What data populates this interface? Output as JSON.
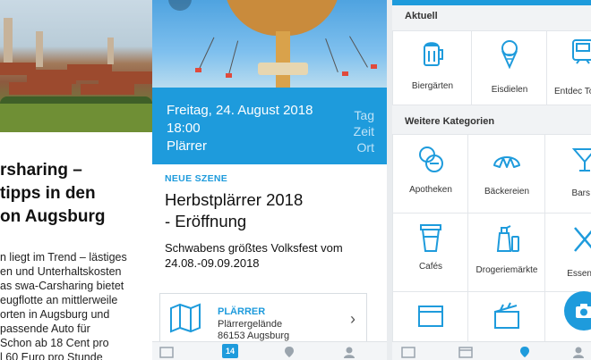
{
  "article": {
    "title_lines": [
      "rsharing –",
      "tipps in den",
      "on Augsburg"
    ],
    "body_lines": [
      "n liegt im Trend – lästiges",
      "en und Unterhaltskosten",
      "as swa-Carsharing bietet",
      "eugflotte an mittlerweile",
      "orten in Augsburg und",
      "passende Auto für",
      "Schon ab 18 Cent pro",
      "l 60 Euro pro Stunde"
    ]
  },
  "event": {
    "date": "Freitag, 24. August 2018",
    "time": "18:00",
    "venue": "Plärrer",
    "col_labels": [
      "Tag",
      "Zeit",
      "Ort"
    ],
    "kicker": "NEUE SZENE",
    "title_lines": [
      "Herbstplärrer 2018",
      "- Eröffnung"
    ],
    "desc_lines": [
      "Schwabens größtes Volksfest vom",
      "24.08.-09.09.2018"
    ],
    "location": {
      "name": "PLÄRRER",
      "line1": "Plärrergelände",
      "line2": "86153 Augsburg",
      "chevron": "›"
    },
    "tab_badge": "14",
    "accent": "#1e9bdc"
  },
  "categories": {
    "section_current": "Aktuell",
    "section_more": "Weitere Kategorien",
    "row1": [
      {
        "label": "Biergärten",
        "icon": "beer-mug-icon"
      },
      {
        "label": "Eisdielen",
        "icon": "ice-cream-icon"
      },
      {
        "label": "Entdec Touri",
        "icon": "train-icon"
      }
    ],
    "row2": [
      {
        "label": "Apotheken",
        "icon": "pill-icon"
      },
      {
        "label": "Bäckereien",
        "icon": "croissant-icon"
      },
      {
        "label": "Bars",
        "icon": "cocktail-icon"
      }
    ],
    "row3": [
      {
        "label": "Cafés",
        "icon": "coffee-cup-icon"
      },
      {
        "label": "Drogeriemärkte",
        "icon": "spray-bottle-icon"
      },
      {
        "label": "Essen",
        "icon": "cutlery-icon"
      }
    ]
  }
}
